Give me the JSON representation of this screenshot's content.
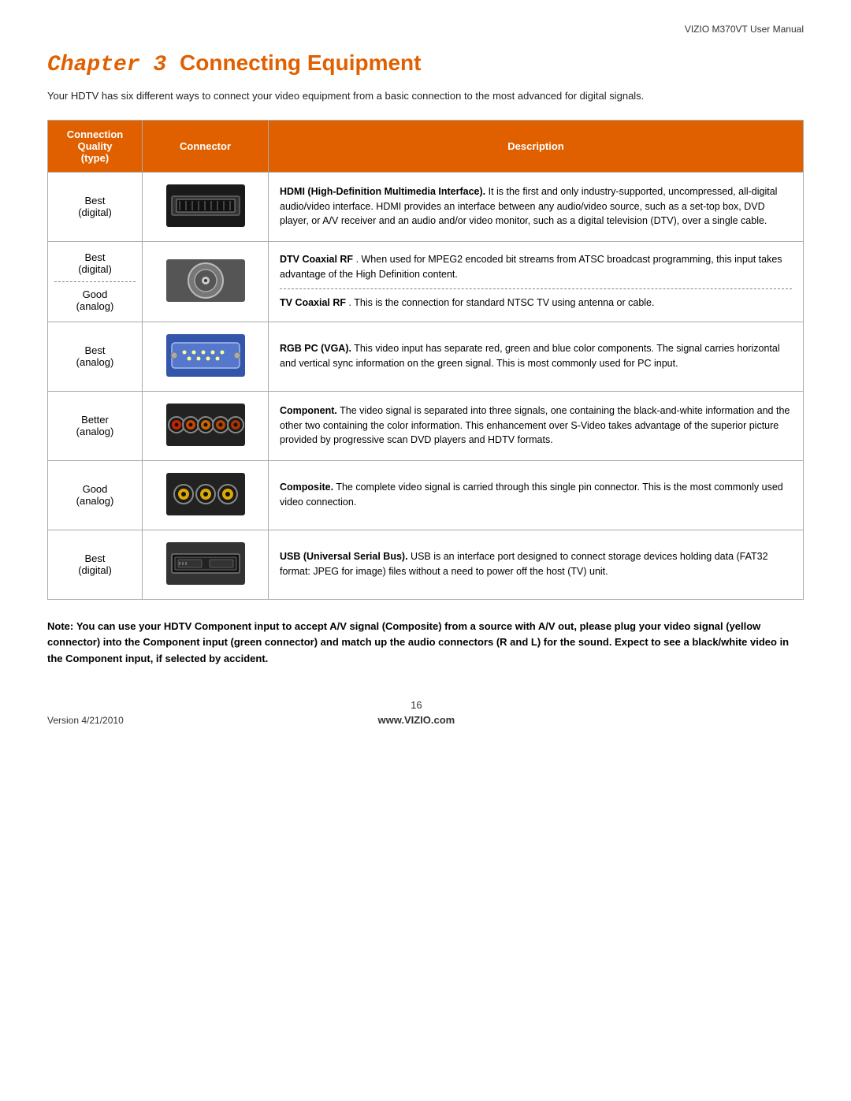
{
  "header": {
    "title": "VIZIO M370VT User Manual"
  },
  "chapter": {
    "number": "3",
    "title": "Connecting Equipment",
    "chapter_label": "Chapter"
  },
  "intro": "Your HDTV has six different ways to connect your video equipment from a basic connection to the most advanced for digital signals.",
  "table": {
    "headers": {
      "quality": "Connection\nQuality\n(type)",
      "connector": "Connector",
      "description": "Description"
    },
    "rows": [
      {
        "quality": "Best\n(digital)",
        "connector_type": "hdmi",
        "description_bold": "HDMI (High-Definition Multimedia Interface).",
        "description": " It is the first and only industry-supported, uncompressed, all-digital audio/video interface. HDMI provides an interface between any audio/video source, such as a set-top box, DVD player, or A/V receiver and an audio and/or video monitor, such as a digital television (DTV), over a single cable."
      },
      {
        "quality_top": "Best\n(digital)",
        "quality_bottom": "Good\n(analog)",
        "connector_type": "coax",
        "description_top_bold": "DTV Coaxial RF",
        "description_top": ". When used for MPEG2 encoded bit streams from ATSC broadcast programming, this input takes advantage of the High Definition content.",
        "description_bottom_bold": "TV Coaxial RF",
        "description_bottom": ". This is the connection for standard NTSC TV using antenna or cable.",
        "split": true
      },
      {
        "quality": "Best\n(analog)",
        "connector_type": "vga",
        "description_bold": "RGB PC (VGA).",
        "description": " This video input has separate red, green and blue color components.  The signal carries horizontal and vertical sync information on the green signal.  This is most commonly used for PC input."
      },
      {
        "quality": "Better\n(analog)",
        "connector_type": "component",
        "description_bold": "Component.",
        "description": " The video signal is separated into three signals, one containing the black-and-white information and the other two containing the color information. This enhancement over S-Video takes advantage of the superior picture provided by progressive scan DVD players and HDTV formats."
      },
      {
        "quality": "Good\n(analog)",
        "connector_type": "composite",
        "description_bold": "Composite.",
        "description": " The complete video signal is carried through this single pin connector. This is the most commonly used video connection."
      },
      {
        "quality": "Best\n(digital)",
        "connector_type": "usb",
        "description_bold": "USB (Universal Serial Bus).",
        "description": " USB is an interface port designed to connect storage devices holding data (FAT32 format: JPEG for image) files without a need to power off the host (TV) unit."
      }
    ]
  },
  "note": {
    "label": "Note:",
    "text": "You can use your HDTV Component input to accept A/V signal (Composite) from a source with A/V out, please plug your video signal (yellow connector) into the Component input (green connector) and match up the audio connectors (R and L) for the sound. Expect to see a black/white video in the Component input, if selected by accident."
  },
  "footer": {
    "version": "Version 4/21/2010",
    "page": "16",
    "website": "www.VIZIO.com"
  },
  "colors": {
    "orange": "#e06000",
    "header_bg": "#e06000",
    "header_text": "#ffffff"
  }
}
